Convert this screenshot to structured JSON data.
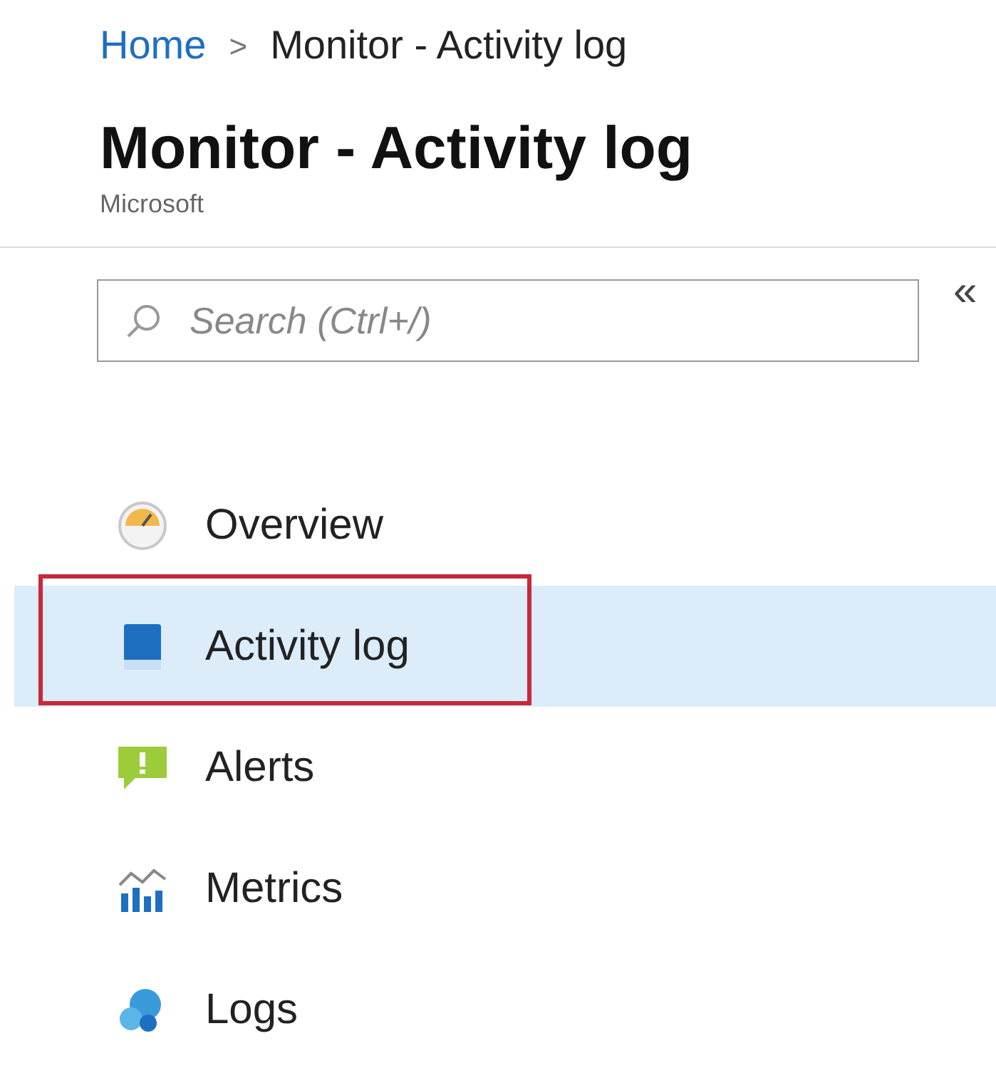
{
  "breadcrumb": [
    {
      "label": "Home",
      "link": true
    },
    {
      "label": "Monitor - Activity log",
      "link": false
    }
  ],
  "breadcrumb_separator": ">",
  "header": {
    "title": "Monitor - Activity log",
    "subtitle": "Microsoft"
  },
  "collapse_button": "«",
  "search": {
    "placeholder": "Search (Ctrl+/)"
  },
  "menu": [
    {
      "label": "Overview",
      "kind": "overview",
      "selected": false,
      "highlighted": false
    },
    {
      "label": "Activity log",
      "kind": "activity",
      "selected": true,
      "highlighted": true
    },
    {
      "label": "Alerts",
      "kind": "alerts",
      "selected": false,
      "highlighted": false
    },
    {
      "label": "Metrics",
      "kind": "metrics",
      "selected": false,
      "highlighted": false
    },
    {
      "label": "Logs",
      "kind": "logs",
      "selected": false,
      "highlighted": false
    }
  ]
}
